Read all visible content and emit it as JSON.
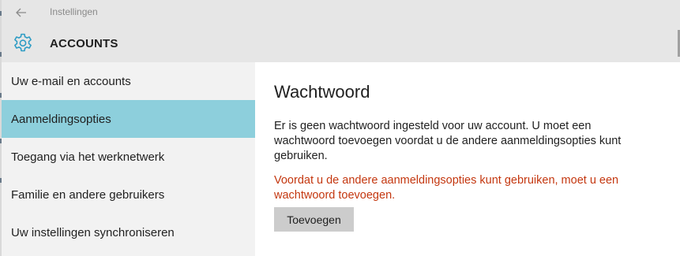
{
  "titlebar": {
    "back_icon": "back-arrow-icon",
    "title": "Instellingen"
  },
  "header": {
    "icon": "gear-icon",
    "title": "ACCOUNTS"
  },
  "sidebar": {
    "items": [
      {
        "label": "Uw e-mail en accounts",
        "selected": false
      },
      {
        "label": "Aanmeldingsopties",
        "selected": true
      },
      {
        "label": "Toegang via het werknetwerk",
        "selected": false
      },
      {
        "label": "Familie en andere gebruikers",
        "selected": false
      },
      {
        "label": "Uw instellingen synchroniseren",
        "selected": false
      }
    ]
  },
  "main": {
    "title": "Wachtwoord",
    "description": "Er is geen wachtwoord ingesteld voor uw account. U moet een wachtwoord toevoegen voordat u de andere aanmeldingsopties kunt gebruiken.",
    "warning": "Voordat u de andere aanmeldingsopties kunt gebruiken, moet u een wachtwoord toevoegen.",
    "add_button_label": "Toevoegen"
  },
  "colors": {
    "selected_item": "#8dcfdc",
    "warning_text": "#c4370f",
    "accent_icon": "#2d9cc4",
    "header_bg": "#e6e6e6",
    "sidebar_bg": "#f2f2f2"
  }
}
